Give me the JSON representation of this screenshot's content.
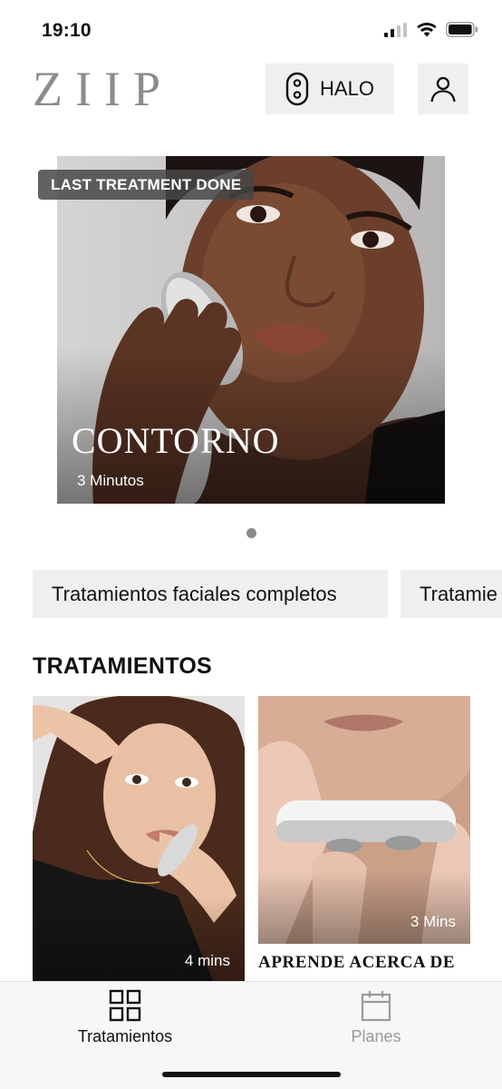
{
  "status_bar": {
    "time": "19:10"
  },
  "header": {
    "logo": "ZIIP",
    "device_button": "HALO"
  },
  "hero": {
    "badge": "LAST TREATMENT DONE",
    "title": "CONTORNO",
    "subtitle": "3 Minutos"
  },
  "chips": [
    "Tratamientos faciales completos",
    "Tratamie"
  ],
  "section_title": "TRATAMIENTOS",
  "cards": [
    {
      "duration": "4 mins"
    },
    {
      "duration": "3 Mins",
      "title": "APRENDE ACERCA DE"
    }
  ],
  "bottom_nav": {
    "items": [
      {
        "label": "Tratamientos"
      },
      {
        "label": "Planes"
      }
    ]
  },
  "colors": {
    "accent": "#111111",
    "inactive": "#9a9a9a",
    "chip_bg": "#efefef"
  }
}
